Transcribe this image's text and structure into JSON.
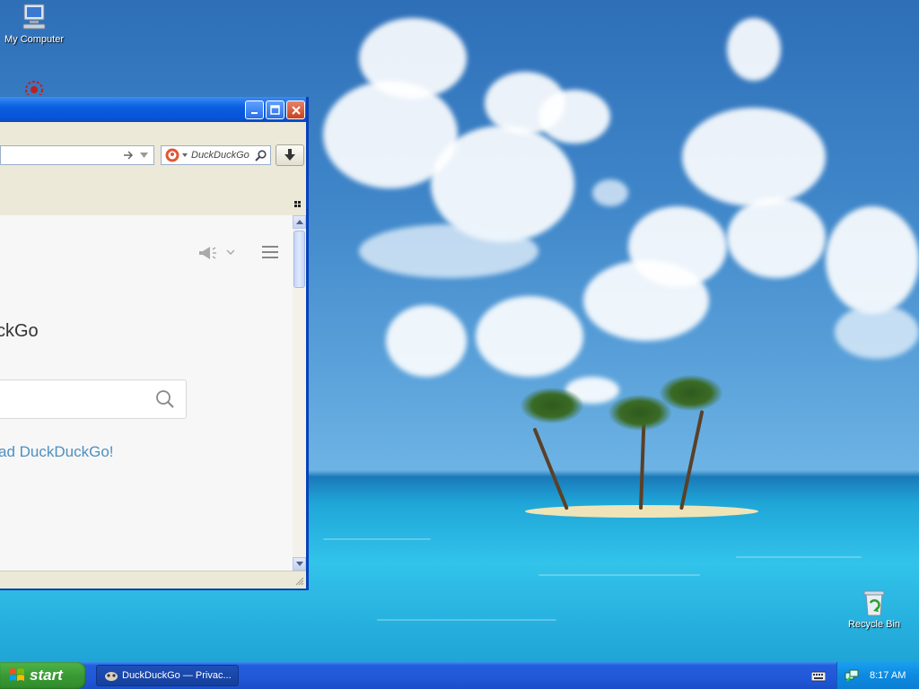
{
  "desktop": {
    "icons": [
      {
        "label": "My Computer"
      },
      {
        "label": ""
      },
      {
        "label": "Recycle Bin"
      }
    ]
  },
  "window": {
    "search_placeholder": "DuckDuckGo",
    "content": {
      "heading_fragment": "ckGo",
      "link_fragment": "ad DuckDuckGo!"
    }
  },
  "taskbar": {
    "start_label": "start",
    "task_label": "DuckDuckGo — Privac...",
    "clock": "8:17 AM"
  },
  "colors": {
    "taskbar_blue": "#245edc",
    "start_green": "#3a9a34",
    "ddg_orange": "#de5833",
    "link_blue": "#4f8fbf"
  }
}
